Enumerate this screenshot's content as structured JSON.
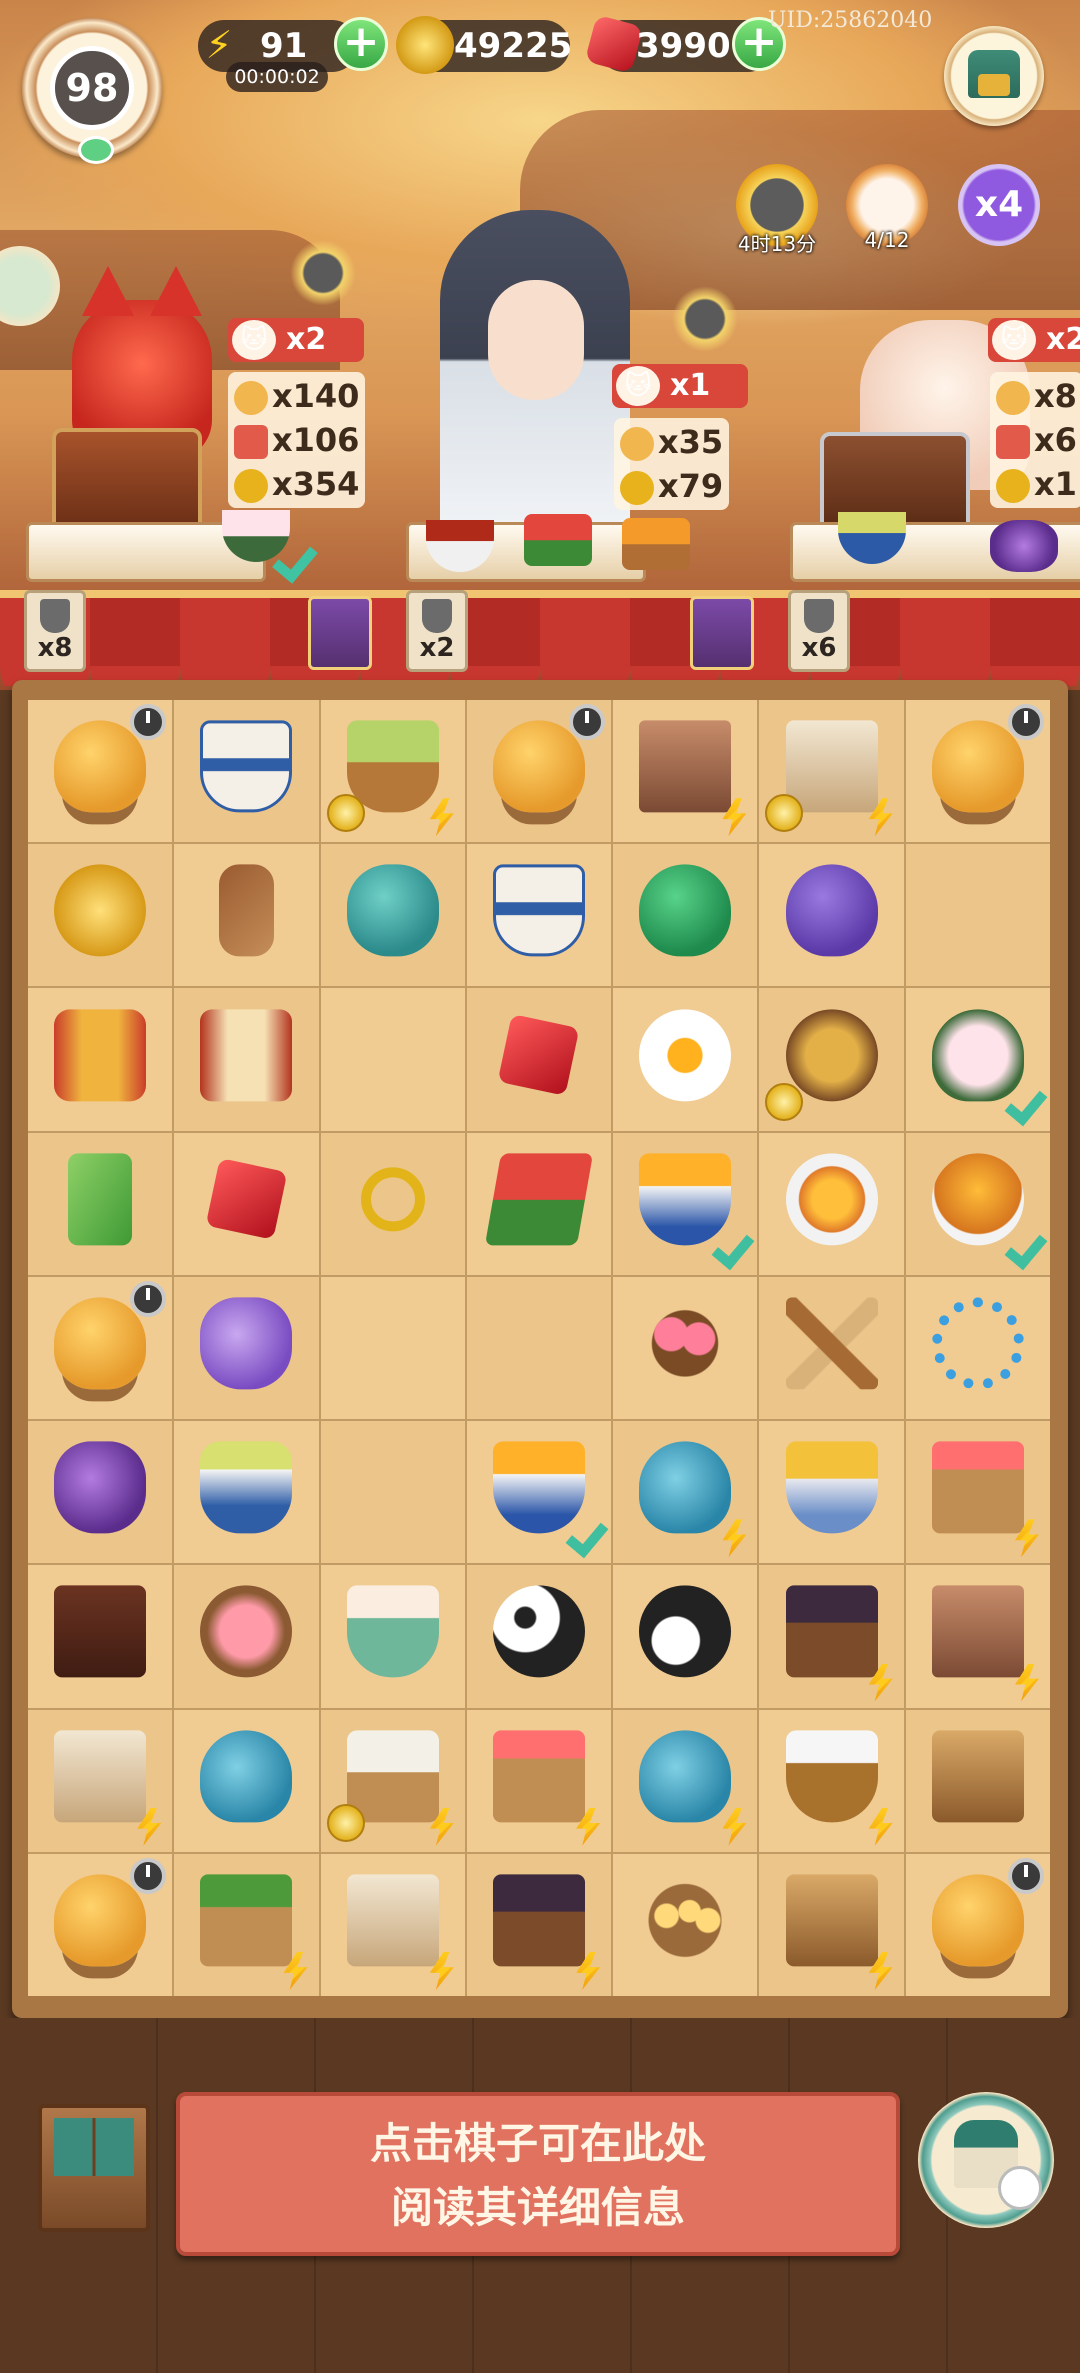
{
  "hud": {
    "level": "98",
    "energy": "91",
    "energy_timer": "00:00:02",
    "coins": "49225",
    "gems": "3990",
    "uid": "UID:25862040"
  },
  "round_buttons": {
    "wok_timer": "4时13分",
    "cat_progress": "4/12",
    "multiplier": "x4"
  },
  "orders": [
    {
      "badge": "x2",
      "rewards": [
        "x140",
        "x106",
        "x354"
      ],
      "counter_tag": "x8"
    },
    {
      "badge": "x1",
      "rewards": [
        "x35",
        "x79"
      ],
      "counter_tag": "x2"
    },
    {
      "badge": "x2",
      "rewards": [
        "x8",
        "x6",
        "x1"
      ],
      "counter_tag": "x6"
    }
  ],
  "board": [
    [
      "chick",
      "cup",
      "basket",
      "chick",
      "loom",
      "scroll-box",
      "chick"
    ],
    [
      "coins",
      "herb",
      "teal-pot",
      "cup",
      "gourd-green",
      "gourd-purple",
      "empty"
    ],
    [
      "lantern",
      "lantern2",
      "empty",
      "ruby",
      "egg",
      "pie",
      "bun"
    ],
    [
      "bamboo",
      "ruby",
      "ring",
      "melon",
      "bowl-egg",
      "rice",
      "roast"
    ],
    [
      "chick",
      "pouch",
      "empty",
      "empty",
      "flowers",
      "brush",
      "bracelet"
    ],
    [
      "pouch2",
      "jar",
      "empty",
      "bowl-egg",
      "teapot",
      "grain",
      "fruit-box"
    ],
    [
      "box",
      "mochi",
      "yogurt",
      "panda",
      "panda-flowers",
      "treasure",
      "loom2"
    ],
    [
      "scroll",
      "teapot2",
      "steamer",
      "fruit-crate",
      "teapot",
      "flour",
      "tools"
    ],
    [
      "chick",
      "melon-box",
      "scroll2",
      "treasure2",
      "chicks",
      "tools2",
      "chick"
    ]
  ],
  "info_text": [
    "点击棋子可在此处",
    "阅读其详细信息"
  ],
  "colors": {
    "accent_green": "#38a845",
    "banner": "#e0725f",
    "check": "#3fbf9f"
  }
}
